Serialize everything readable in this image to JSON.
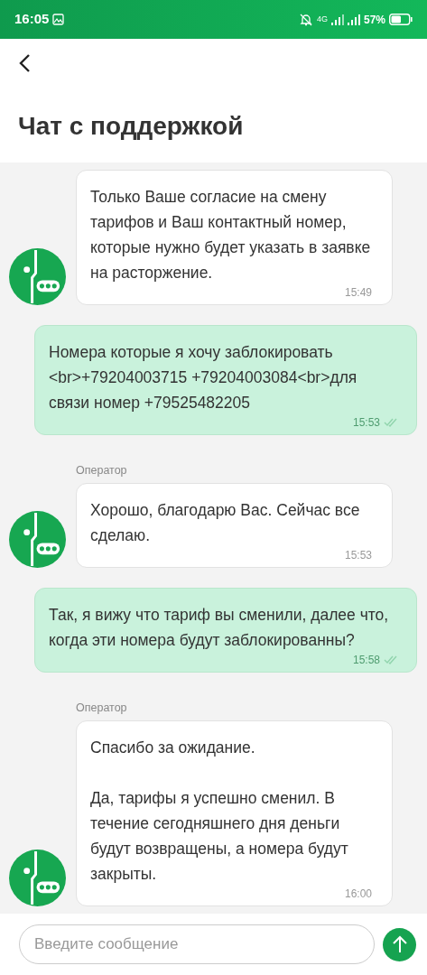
{
  "status_bar": {
    "time": "16:05",
    "network": "4G",
    "battery": "57%"
  },
  "header": {
    "title": "Чат с поддержкой"
  },
  "messages": [
    {
      "kind": "operator",
      "text": "Только Ваше согласие на смену тарифов и Ваш контактный номер, которые нужно будет указать в заявке на расторжение.",
      "time": "15:49"
    },
    {
      "kind": "user",
      "text": "Номера которые я хочу заблокировать <br>+79204003715 +79204003084<br>для связи номер +79525482205",
      "time": "15:53",
      "read": true
    },
    {
      "kind": "operator",
      "sender": "Оператор",
      "text": "Хорошо, благодарю Вас. Сейчас все сделаю.",
      "time": "15:53"
    },
    {
      "kind": "user",
      "text": "Так, я вижу что тариф вы сменили, далее что, когда эти номера будут заблокированны?",
      "time": "15:58",
      "read": true
    },
    {
      "kind": "operator",
      "sender": "Оператор",
      "text": "Спасибо за ожидание.\n\nДа, тарифы я успешно сменил. В течение сегодняшнего дня деньги будут возвращены, а номера будут закрыты.",
      "time": "16:00"
    }
  ],
  "composer": {
    "placeholder": "Введите сообщение"
  }
}
